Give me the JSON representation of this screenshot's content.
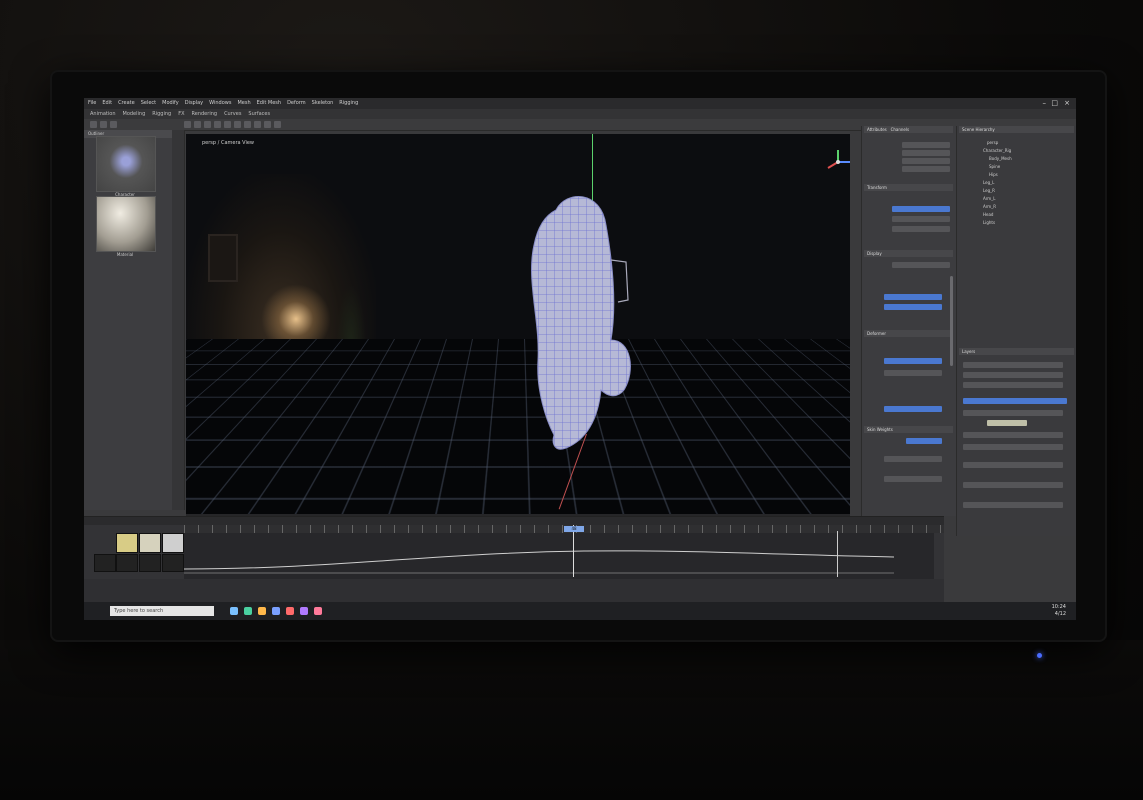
{
  "window": {
    "menu_top": [
      "File",
      "Edit",
      "Create",
      "Select",
      "Modify",
      "Display",
      "Windows",
      "Mesh",
      "Edit Mesh",
      "Deform",
      "Skeleton",
      "Rigging"
    ],
    "menu_second": [
      "Animation",
      "Modeling",
      "Rigging",
      "FX",
      "Rendering",
      "Curves",
      "Surfaces"
    ],
    "win_controls": [
      "–",
      "□",
      "×"
    ]
  },
  "left_panel": {
    "header": "Outliner",
    "thumbnails": [
      {
        "caption": "Character"
      },
      {
        "caption": "Material"
      }
    ]
  },
  "viewport": {
    "label": "persp / Camera View",
    "colors": {
      "grid": "#505a6e",
      "mesh": "#b6b9d6",
      "mesh_wire": "#6b6fd3",
      "axis_y": "#5bd16c",
      "axis_x": "#c05050"
    }
  },
  "attribute_panel": {
    "tabs": [
      "Attributes",
      "Channels"
    ],
    "sections": [
      "Transform",
      "Display",
      "Deformer",
      "Skin Weights"
    ],
    "accent": "#4a78d0"
  },
  "outliner_panel": {
    "title": "Scene Hierarchy",
    "items": [
      "persp",
      "Character_Rig",
      "Body_Mesh",
      "Spine",
      "Hips",
      "Leg_L",
      "Leg_R",
      "Arm_L",
      "Arm_R",
      "Head",
      "Lights"
    ],
    "lower_section": "Layers"
  },
  "timeline": {
    "swatch_colors": [
      "#d8cc86",
      "#d6d2bd",
      "#cfcfcf",
      "#e0ddd0"
    ],
    "playhead_label": "48"
  },
  "taskbar": {
    "search_placeholder": "Type here to search",
    "time": "10:24",
    "date": "4/12",
    "app_colors": [
      "#7ac0ff",
      "#4ad0a0",
      "#ffb84a",
      "#7aa0ff",
      "#ff6a6a",
      "#b07aff",
      "#ff7a9a"
    ]
  }
}
